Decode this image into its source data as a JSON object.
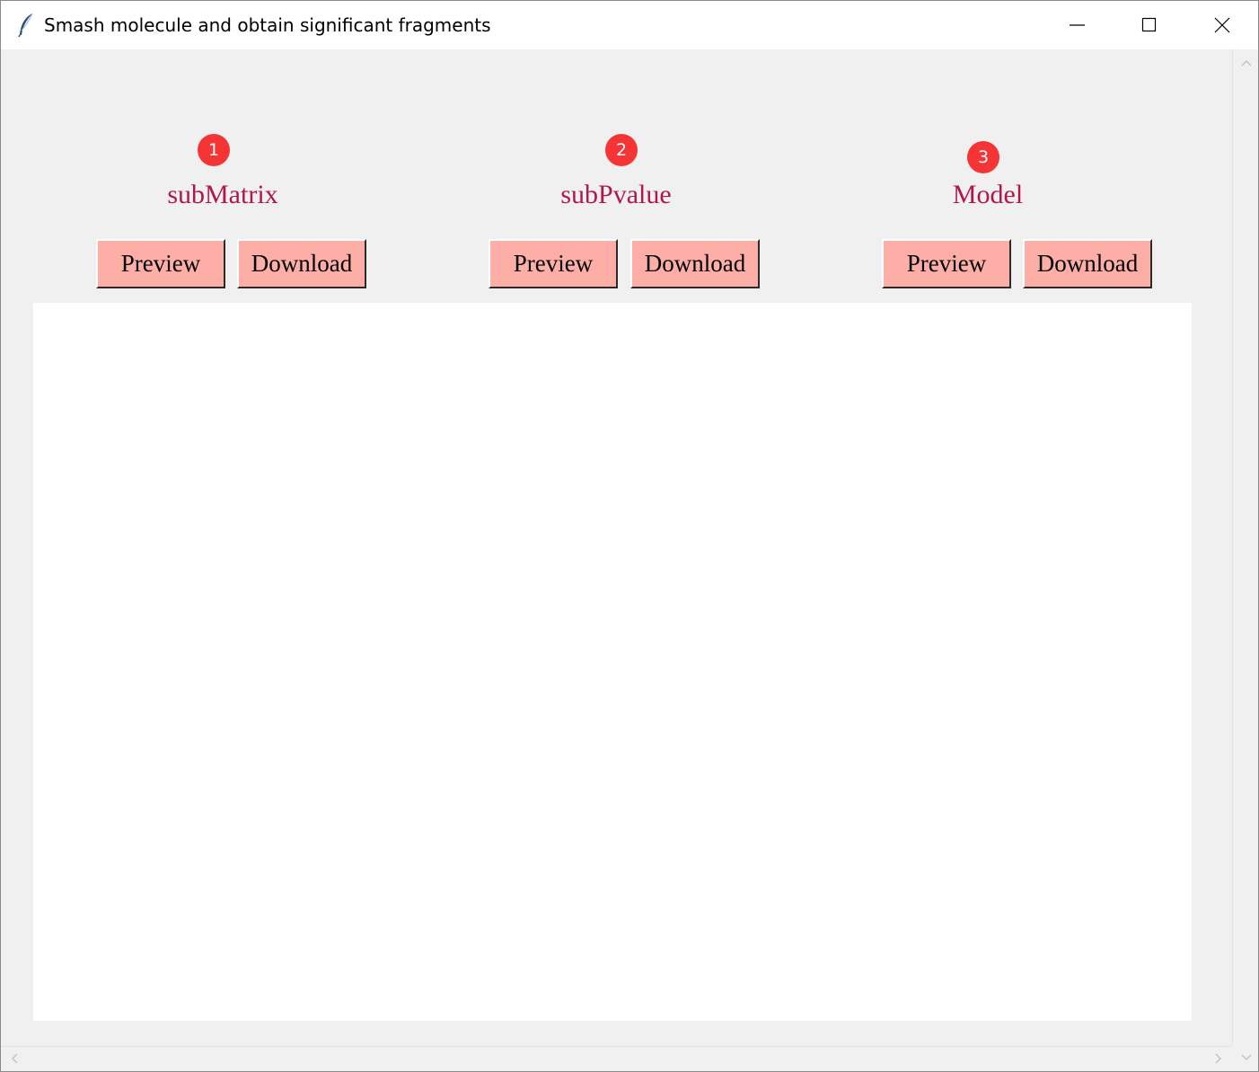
{
  "window": {
    "title": "Smash molecule and obtain significant fragments",
    "icon": "feather-icon",
    "controls": {
      "minimize": "minimize-icon",
      "maximize": "maximize-icon",
      "close": "close-icon"
    }
  },
  "sections": [
    {
      "badge": "1",
      "label": "subMatrix",
      "preview_label": "Preview",
      "download_label": "Download"
    },
    {
      "badge": "2",
      "label": "subPvalue",
      "preview_label": "Preview",
      "download_label": "Download"
    },
    {
      "badge": "3",
      "label": "Model",
      "preview_label": "Preview",
      "download_label": "Download"
    }
  ],
  "colors": {
    "badge": "#f53535",
    "label": "#b0184a",
    "button_bg": "#fdaea6",
    "canvas_bg": "#ffffff",
    "window_bg": "#f0f0f0"
  },
  "scrollbars": {
    "vertical": [
      "chevron-up-icon",
      "chevron-down-icon"
    ],
    "horizontal": [
      "chevron-left-icon",
      "chevron-right-icon"
    ]
  }
}
